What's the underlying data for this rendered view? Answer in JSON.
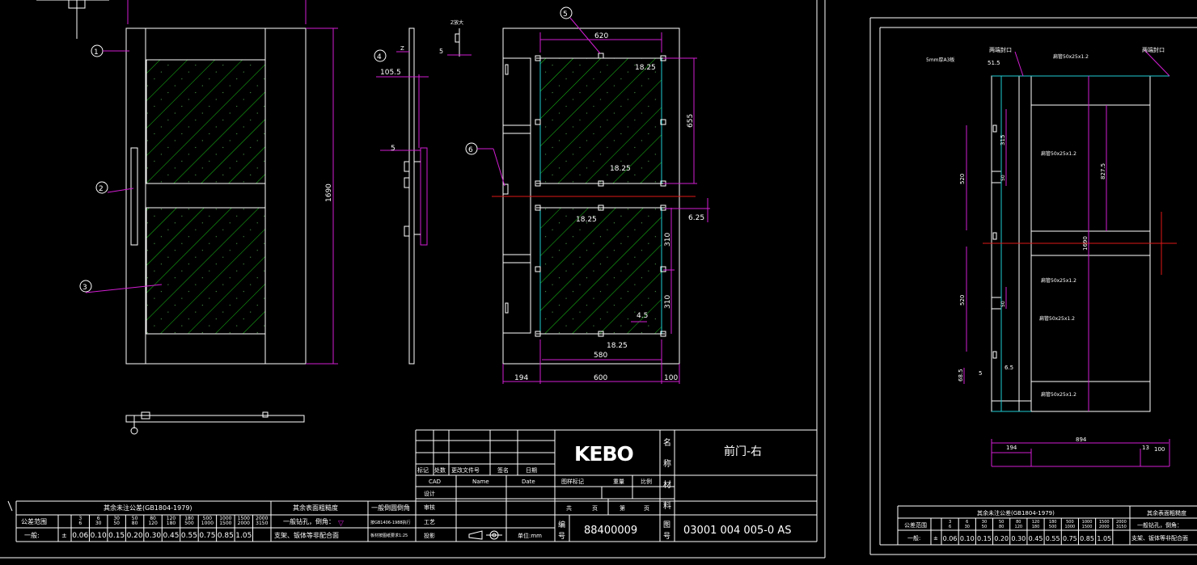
{
  "balloons": [
    "1",
    "2",
    "3",
    "4",
    "5",
    "6"
  ],
  "dims": {
    "w620": "620",
    "d18a": "18.25",
    "d655": "655",
    "d18b": "18.25",
    "d18c": "18.25",
    "d625": "6.25",
    "d310a": "310",
    "d310b": "310",
    "d45": "4.5",
    "d18d": "18.25",
    "w580": "580",
    "b194": "194",
    "b600": "600",
    "b100": "100",
    "h1690": "1690",
    "s105": "105.5",
    "s5a": "5",
    "s5b": "5",
    "sz": "Z",
    "s5c": "5",
    "zlabel": "Z放大"
  },
  "title_block": {
    "logo": "KEBO",
    "name_cell": "名称",
    "part_name": "前门-右",
    "material": "材料",
    "drawing_no_label": "图号",
    "drawing_no": "03001 004 005-0 AS",
    "code_label": "编号",
    "code": "88400009",
    "rev_headers": [
      "标记",
      "处数",
      "更改文件号",
      "签名",
      "日期"
    ],
    "sign_headers": [
      "CAD",
      "Name",
      "Date"
    ],
    "roles": [
      "设计",
      "审核",
      "工艺",
      "投影"
    ],
    "stage": "图样标记",
    "weight": "重量",
    "scale": "比例",
    "total": "共",
    "page": "页",
    "sheet": "第",
    "unit": "单位:mm"
  },
  "tolerance": {
    "title": "其余未注公差(GB1804-1979)",
    "range_label": "公差范围",
    "general_label": "一般:",
    "pm": "±",
    "ranges": [
      "3\n6",
      "6\n30",
      "30\n50",
      "50\n80",
      "80\n120",
      "120\n180",
      "180\n500",
      "500\n1000",
      "1000\n1500",
      "1500\n2000",
      "2000\n3150"
    ],
    "values": [
      "0.06",
      "0.10",
      "0.15",
      "0.20",
      "0.30",
      "0.45",
      "0.55",
      "0.75",
      "0.85",
      "1.05"
    ],
    "surface_title": "其余表面粗糙度",
    "drill_note": "一般钻孔，倒角：",
    "burr_title": "一般倒圆倒角",
    "support_note": "支架、钣体等非配合面",
    "burr_note": "按GB1406-1988执行",
    "sheet_note": "板材按图纸要求1:25"
  },
  "right_sheet": {
    "top_labels": [
      "两端封口",
      "两端封口"
    ],
    "plate_label": "5mm厚A3板",
    "tube_labels": [
      "扁管50x25x1.2",
      "扁管50x25x1.2",
      "扁管50x25x1.2",
      "扁管50x25x1.2",
      "扁管50x25x1.2"
    ],
    "dims": [
      "51.5",
      "315",
      "520",
      "50",
      "827.5",
      "1690",
      "520",
      "50",
      "68.5",
      "5",
      "6.5",
      "894",
      "194",
      "13",
      "100"
    ],
    "tol_title": "其余未注公差(GB1804-1979)",
    "tol_values": [
      "0.06",
      "0.10",
      "0.15",
      "0.20",
      "0.30",
      "0.45",
      "0.55",
      "0.75",
      "0.85",
      "1.05"
    ],
    "surface_title": "其余表面粗糙度",
    "drill_note": "一般钻孔，倒角：",
    "support_note": "支架、钣体等非配合面"
  }
}
